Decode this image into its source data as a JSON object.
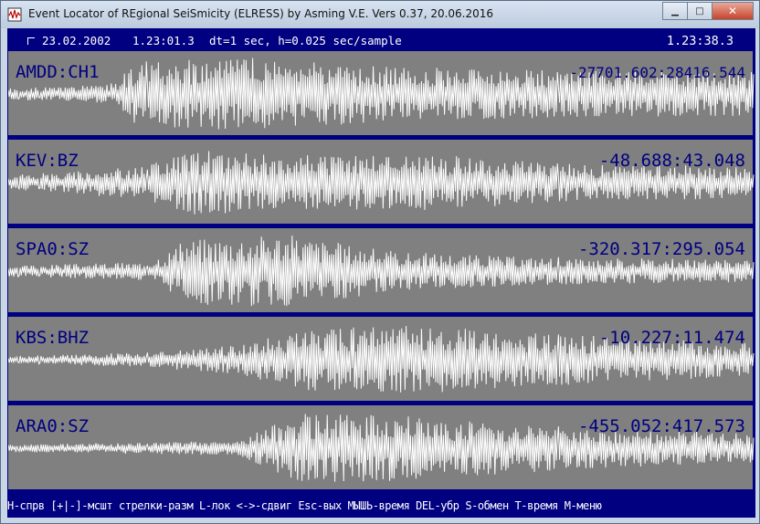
{
  "window": {
    "title": "Event Locator of REgional SeiSmicity (ELRESS) by Asming V.E. Vers 0.37, 20.06.2016"
  },
  "header": {
    "date": "23.02.2002",
    "start_time": "1.23:01.3",
    "params": "dt=1 sec, h=0.025 sec/sample",
    "cursor_time": "1.23:38.3"
  },
  "channels": [
    {
      "name": "AMDD:CH1",
      "range": "-27701.602:28416.544"
    },
    {
      "name": "KEV:BZ",
      "range": "-48.688:43.048"
    },
    {
      "name": "SPA0:SZ",
      "range": "-320.317:295.054"
    },
    {
      "name": "KBS:BHZ",
      "range": "-10.227:11.474"
    },
    {
      "name": "ARA0:SZ",
      "range": "-455.052:417.573"
    }
  ],
  "hints": "H-спрв [+|-]-мсшт стрелки-разм L-лок <->-сдвиг Esc-вых МЫШЬ-время DEL-убр S-обмен T-время M-меню",
  "colors": {
    "background": "#000080",
    "trace_area": "#808080",
    "trace": "#ffffff",
    "label_text": "#000080"
  }
}
